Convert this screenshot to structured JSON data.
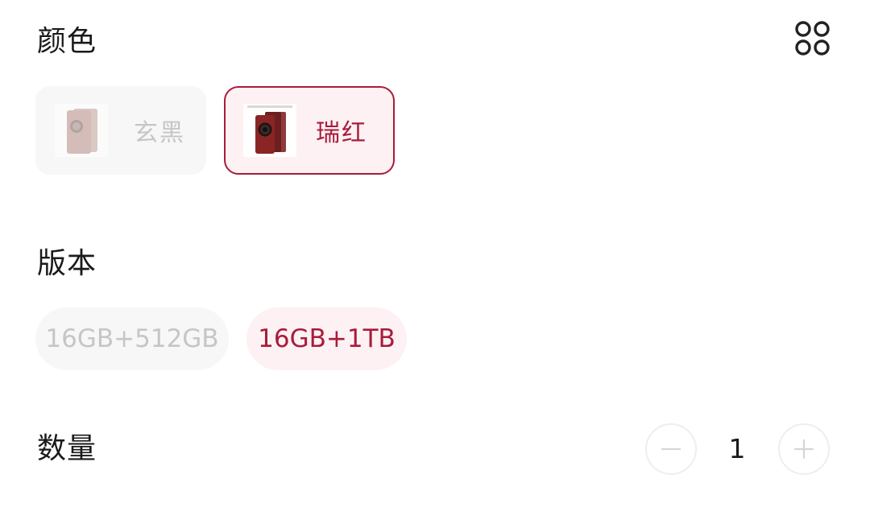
{
  "color_section": {
    "title": "颜色",
    "options": [
      {
        "label": "玄黑",
        "state": "disabled"
      },
      {
        "label": "瑞红",
        "state": "selected"
      }
    ],
    "grid_icon": "grid-four-circles-icon"
  },
  "version_section": {
    "title": "版本",
    "options": [
      {
        "label": "16GB+512GB",
        "state": "disabled"
      },
      {
        "label": "16GB+1TB",
        "state": "selected"
      }
    ]
  },
  "quantity_section": {
    "title": "数量",
    "value": "1",
    "minus_icon": "minus-icon",
    "plus_icon": "plus-icon"
  },
  "colors": {
    "accent": "#a81c3a",
    "selected_bg": "#fdf1f3",
    "disabled_bg": "#f7f7f7",
    "disabled_text": "#c6c6c6"
  }
}
